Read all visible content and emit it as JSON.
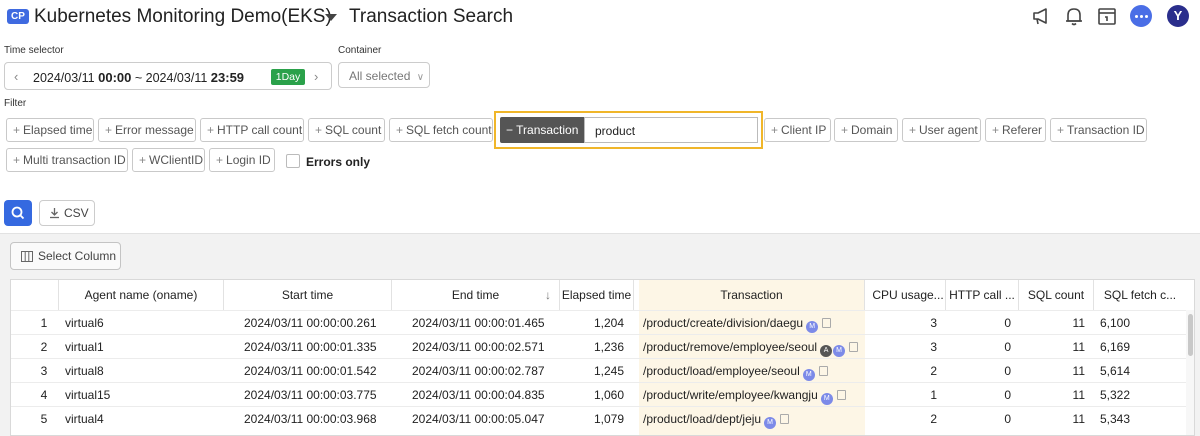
{
  "header": {
    "project_badge": "CP",
    "project_name": "Kubernetes Monitoring Demo(EKS)",
    "page_title": "Transaction Search",
    "user_initial": "Y",
    "icons": [
      "megaphone-icon",
      "bell-icon",
      "calendar-icon",
      "chat-icon",
      "avatar"
    ]
  },
  "time_selector": {
    "label": "Time selector",
    "start_date": "2024/03/11",
    "start_time": "00:00",
    "separator": "~",
    "end_date": "2024/03/11",
    "end_time": "23:59",
    "range_badge": "1Day"
  },
  "container": {
    "label": "Container",
    "value": "All selected"
  },
  "filter": {
    "label": "Filter",
    "chips": [
      "Elapsed time",
      "Error message",
      "HTTP call count",
      "SQL count",
      "SQL fetch count",
      "Client IP",
      "Domain",
      "User agent",
      "Referer",
      "Transaction ID",
      "Multi transaction ID",
      "WClientID",
      "Login ID"
    ],
    "active_chip": "Transaction",
    "active_value": "product",
    "errors_only_label": "Errors only"
  },
  "actions": {
    "csv_label": "CSV",
    "select_column_label": "Select Column"
  },
  "table": {
    "headers": [
      "Agent name (oname)",
      "Start time",
      "End time",
      "Elapsed time",
      "Transaction",
      "CPU usage...",
      "HTTP call ...",
      "SQL count",
      "SQL fetch c..."
    ],
    "rows": [
      {
        "no": "1",
        "agent": "virtual6",
        "start": "2024/03/11 00:00:00.261",
        "end": "2024/03/11 00:00:01.465",
        "elapsed": "1,204",
        "transaction": "/product/create/division/daegu",
        "badges": [
          "M"
        ],
        "cpu": "3",
        "http": "0",
        "sql": "11",
        "fetch": "6,100"
      },
      {
        "no": "2",
        "agent": "virtual1",
        "start": "2024/03/11 00:00:01.335",
        "end": "2024/03/11 00:00:02.571",
        "elapsed": "1,236",
        "transaction": "/product/remove/employee/seoul",
        "badges": [
          "A",
          "M"
        ],
        "cpu": "3",
        "http": "0",
        "sql": "11",
        "fetch": "6,169"
      },
      {
        "no": "3",
        "agent": "virtual8",
        "start": "2024/03/11 00:00:01.542",
        "end": "2024/03/11 00:00:02.787",
        "elapsed": "1,245",
        "transaction": "/product/load/employee/seoul",
        "badges": [
          "M"
        ],
        "cpu": "2",
        "http": "0",
        "sql": "11",
        "fetch": "5,614"
      },
      {
        "no": "4",
        "agent": "virtual15",
        "start": "2024/03/11 00:00:03.775",
        "end": "2024/03/11 00:00:04.835",
        "elapsed": "1,060",
        "transaction": "/product/write/employee/kwangju",
        "badges": [
          "M"
        ],
        "cpu": "1",
        "http": "0",
        "sql": "11",
        "fetch": "5,322"
      },
      {
        "no": "5",
        "agent": "virtual4",
        "start": "2024/03/11 00:00:03.968",
        "end": "2024/03/11 00:00:05.047",
        "elapsed": "1,079",
        "transaction": "/product/load/dept/jeju",
        "badges": [
          "M"
        ],
        "cpu": "2",
        "http": "0",
        "sql": "11",
        "fetch": "5,343"
      }
    ]
  },
  "colors": {
    "accent": "#3569e0",
    "highlight_border": "#f0b62a",
    "badge_green": "#2aa14a",
    "transaction_column_bg": "#fdf6e6"
  }
}
